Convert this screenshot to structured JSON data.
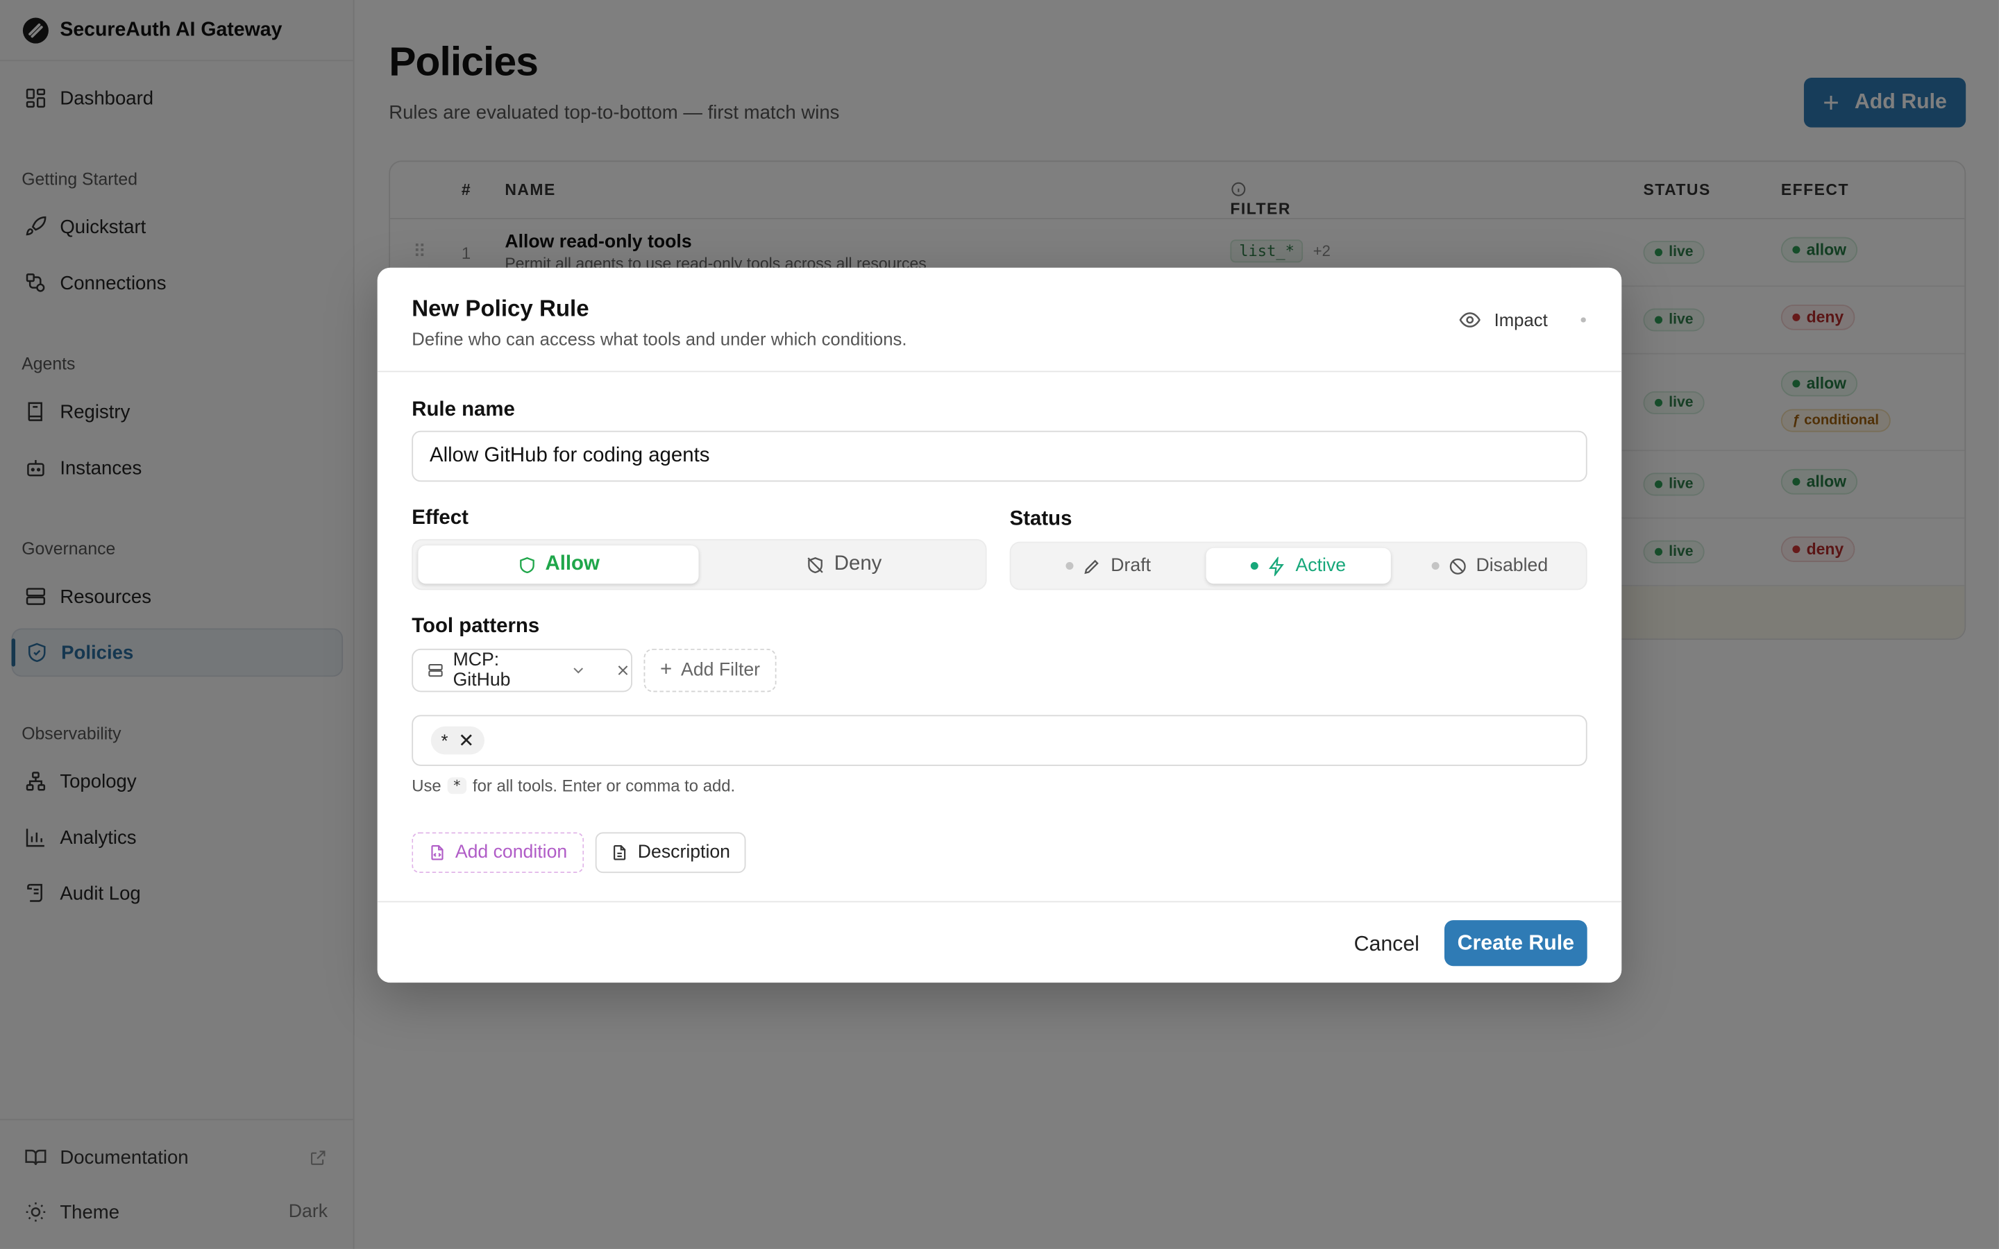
{
  "brand": {
    "name": "SecureAuth AI Gateway"
  },
  "sidebar": {
    "dashboard": "Dashboard",
    "sections": {
      "getting_started": "Getting Started",
      "agents": "Agents",
      "governance": "Governance",
      "observability": "Observability"
    },
    "items": {
      "quickstart": "Quickstart",
      "connections": "Connections",
      "registry": "Registry",
      "instances": "Instances",
      "resources": "Resources",
      "policies": "Policies",
      "topology": "Topology",
      "analytics": "Analytics",
      "audit_log": "Audit Log"
    },
    "footer": {
      "documentation": "Documentation",
      "theme": "Theme",
      "theme_value": "Dark"
    }
  },
  "page": {
    "title": "Policies",
    "subtitle": "Rules are evaluated top-to-bottom — first match wins",
    "add_rule": "Add Rule"
  },
  "table": {
    "headers": {
      "num": "#",
      "name": "NAME",
      "filter": "FILTER",
      "status": "STATUS",
      "effect": "EFFECT"
    },
    "rows": [
      {
        "num": "1",
        "name": "Allow read-only tools",
        "desc": "Permit all agents to use read-only tools across all resources",
        "filter": "list_*",
        "filter_more": "+2",
        "status": "live",
        "effect": "allow"
      },
      {
        "status": "live",
        "effect": "deny"
      },
      {
        "status": "live",
        "effect": "allow",
        "effect_extra": "ƒ conditional"
      },
      {
        "status": "live",
        "effect": "allow"
      },
      {
        "status": "live",
        "effect": "deny"
      }
    ]
  },
  "modal": {
    "title": "New Policy Rule",
    "subtitle": "Define who can access what tools and under which conditions.",
    "impact": "Impact",
    "rule_name_label": "Rule name",
    "rule_name_value": "Allow GitHub for coding agents",
    "effect_label": "Effect",
    "effect_options": {
      "allow": "Allow",
      "deny": "Deny"
    },
    "effect_selected": "Allow",
    "status_label": "Status",
    "status_options": {
      "draft": "Draft",
      "active": "Active",
      "disabled": "Disabled"
    },
    "status_selected": "Active",
    "tool_patterns_label": "Tool patterns",
    "filter_chip": "MCP: GitHub",
    "add_filter": "Add Filter",
    "tag": "*",
    "help_prefix": "Use",
    "help_code": "*",
    "help_suffix": "for all tools. Enter or comma to add.",
    "add_condition": "Add condition",
    "description": "Description",
    "cancel": "Cancel",
    "create": "Create Rule"
  },
  "colors": {
    "primary": "#2f7bb5",
    "allow_green": "#1fa64a",
    "deny_red": "#cf3434",
    "condition_purple": "#b05cc7",
    "active_teal": "#17a77a"
  }
}
